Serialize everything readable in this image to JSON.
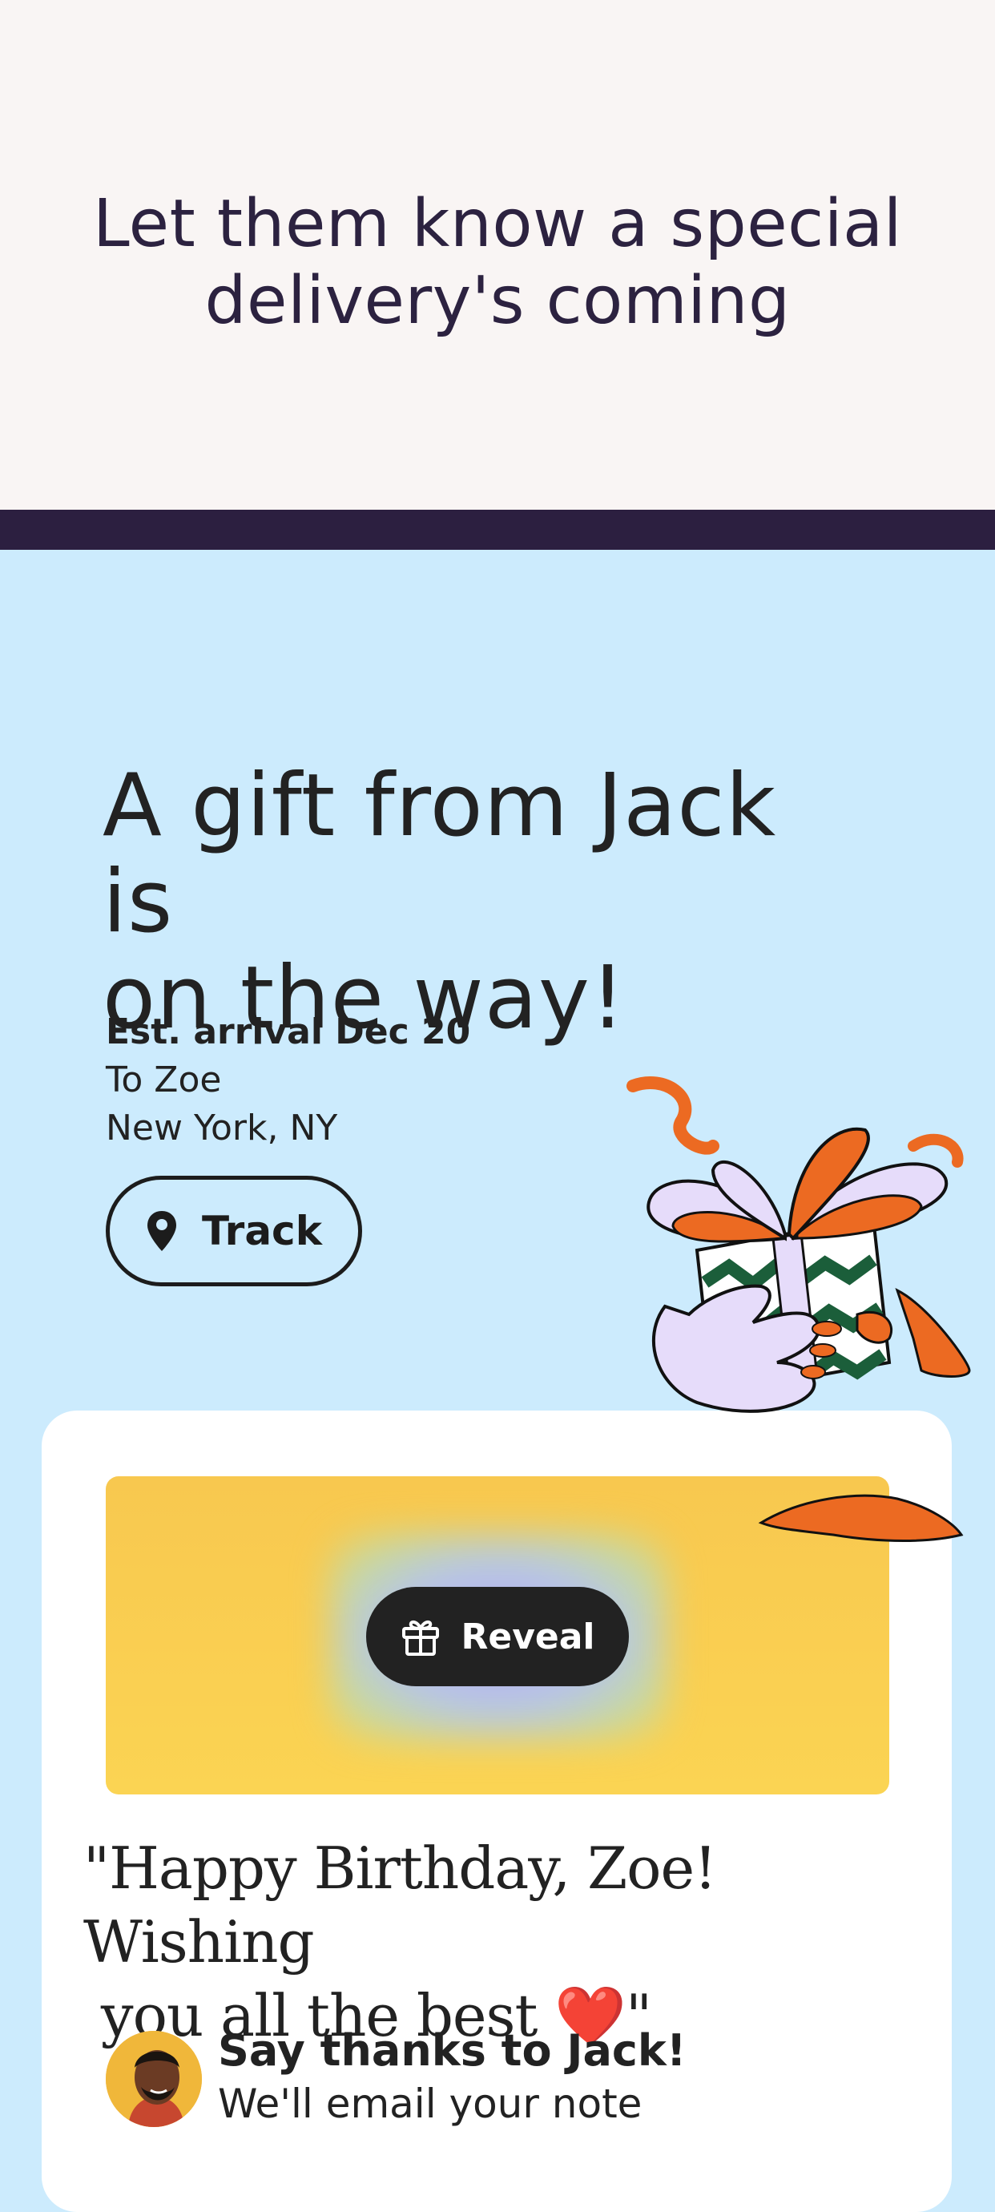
{
  "banner": {
    "title_line1": "Let them know a special",
    "title_line2": "delivery's coming"
  },
  "hero": {
    "title_line1": "A gift from Jack is",
    "title_line2": "on the way!"
  },
  "delivery": {
    "arrival": "Est. arrival Dec 20",
    "recipient": "To Zoe",
    "location": "New York, NY"
  },
  "track_button": {
    "label": "Track",
    "icon": "location-pin-icon"
  },
  "gift": {
    "reveal_label": "Reveal",
    "reveal_icon": "gift-icon"
  },
  "message": {
    "line1": "\"Happy Birthday, Zoe! Wishing",
    "line2_text": "you all the best ",
    "emoji": "❤️",
    "line2_end": "\""
  },
  "thanks": {
    "title": "Say thanks to Jack!",
    "subtitle": "We'll email your note"
  },
  "colors": {
    "banner_bg": "#f9f5f4",
    "band": "#2c1f40",
    "page_bg": "#ccebfd",
    "gift_bg": "#f8c84f",
    "button_dark": "#222222",
    "ribbon_orange": "#ec6a22",
    "ribbon_lilac": "#e6dcfa"
  }
}
